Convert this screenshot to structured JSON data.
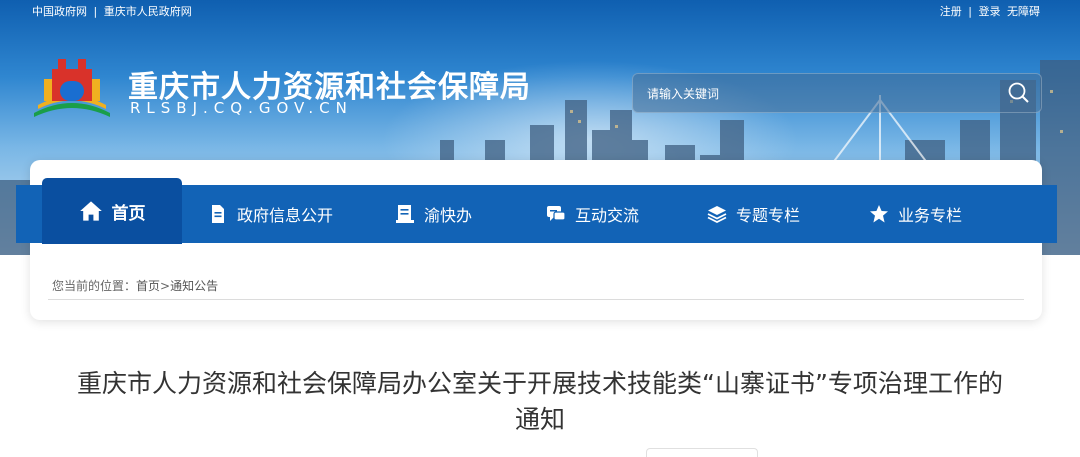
{
  "top_links_left": [
    "中国政府网",
    "|",
    "重庆市人民政府网"
  ],
  "top_links_right": [
    "注册",
    "|",
    "登录",
    "无障碍"
  ],
  "site": {
    "title": "重庆市人力资源和社会保障局",
    "subtitle": "RLSBJ.CQ.GOV.CN"
  },
  "search": {
    "placeholder": "请输入关键词",
    "icon": "search-icon"
  },
  "nav": [
    {
      "label": "首页",
      "icon": "home-icon"
    },
    {
      "label": "政府信息公开",
      "icon": "document-icon"
    },
    {
      "label": "渝快办",
      "icon": "book-icon"
    },
    {
      "label": "互动交流",
      "icon": "chat-icon"
    },
    {
      "label": "专题专栏",
      "icon": "layers-icon"
    },
    {
      "label": "业务专栏",
      "icon": "star-icon"
    }
  ],
  "breadcrumb": {
    "prefix": "您当前的位置：",
    "home": "首页",
    "sep": ">",
    "current": "通知公告"
  },
  "article": {
    "title_line1": "重庆市人力资源和社会保障局办公室关于开展技术技能类“山寨证书”专项治理工作的",
    "title_line2": "通知"
  },
  "colors": {
    "nav_bg": "#1263b6",
    "nav_active": "#0a4fa0",
    "banner_top": "#0f5fb0"
  }
}
